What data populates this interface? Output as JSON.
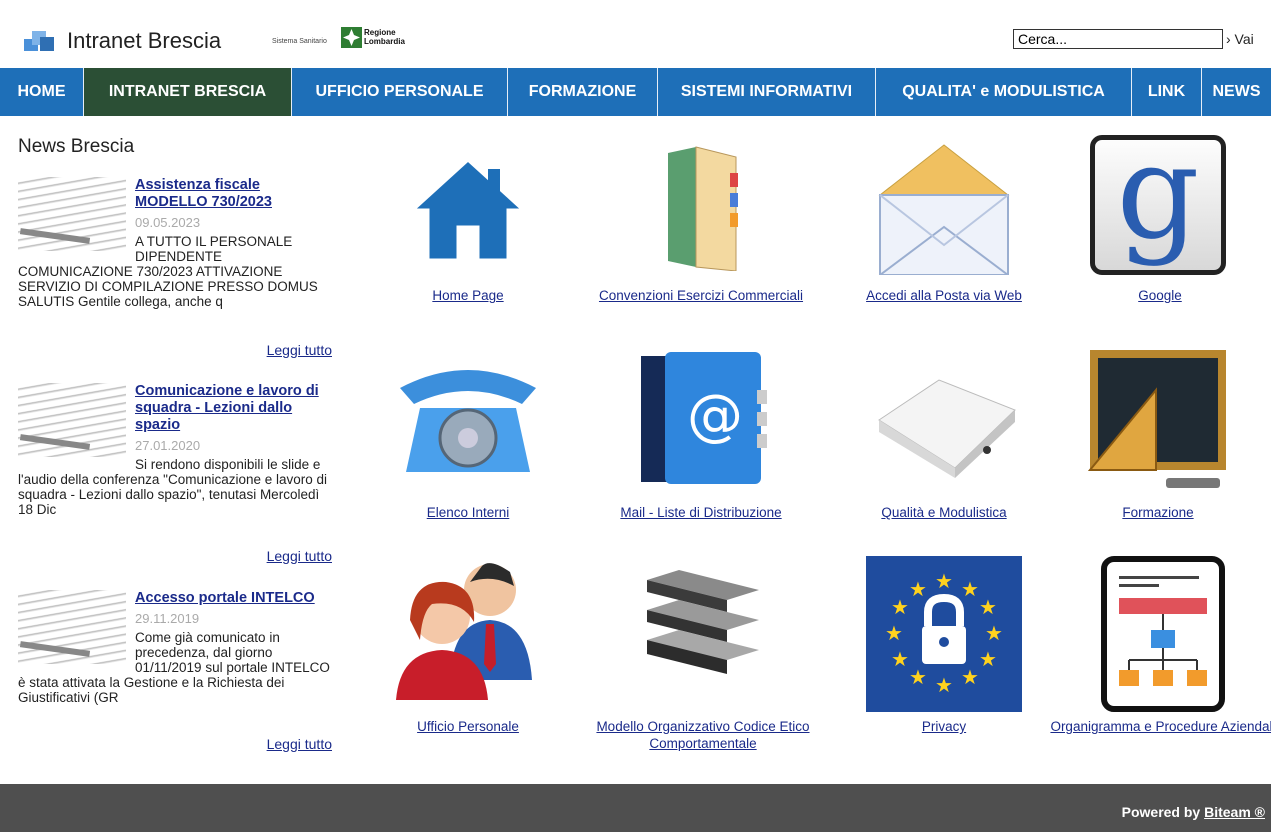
{
  "header": {
    "site_title": "Intranet Brescia",
    "sistema_sanitario": "Sistema Sanitario",
    "regione_line1": "Regione",
    "regione_line2": "Lombardia",
    "search_value": "Cerca...",
    "search_button": "› Vai"
  },
  "nav": {
    "items": [
      {
        "label": "HOME"
      },
      {
        "label": "INTRANET BRESCIA"
      },
      {
        "label": "UFFICIO PERSONALE"
      },
      {
        "label": "FORMAZIONE"
      },
      {
        "label": "SISTEMI INFORMATIVI"
      },
      {
        "label": "QUALITA' e MODULISTICA"
      },
      {
        "label": "LINK"
      },
      {
        "label": "NEWS"
      }
    ]
  },
  "news": {
    "title": "News Brescia",
    "items": [
      {
        "title": "Assistenza fiscale MODELLO 730/2023",
        "date": "09.05.2023",
        "body": "A TUTTO IL PERSONALE DIPENDENTE COMUNICAZIONE 730/2023 ATTIVAZIONE SERVIZIO DI COMPILAZIONE PRESSO DOMUS SALUTIS Gentile collega, anche q",
        "more": "Leggi tutto"
      },
      {
        "title": "Comunicazione e lavoro di squadra - Lezioni dallo spazio",
        "date": "27.01.2020",
        "body": "Si rendono disponibili le slide e l'audio della conferenza \"Comunicazione e lavoro di squadra - Lezioni dallo spazio\", tenutasi Mercoledì 18 Dic",
        "more": "Leggi tutto"
      },
      {
        "title": "Accesso portale INTELCO",
        "date": "29.11.2019",
        "body": "Come già comunicato in precedenza, dal giorno 01/11/2019 sul portale INTELCO è stata attivata la Gestione e la Richiesta dei Giustificativi (GR",
        "more": "Leggi tutto"
      }
    ]
  },
  "tiles": [
    {
      "label": "Home Page",
      "icon": "house-icon"
    },
    {
      "label": "Convenzioni Esercizi Commerciali",
      "icon": "folder-icon"
    },
    {
      "label": "Accedi alla Posta via Web",
      "icon": "envelope-icon"
    },
    {
      "label": "Google",
      "icon": "google-icon"
    },
    {
      "label": "Elenco Interni",
      "icon": "telephone-icon"
    },
    {
      "label": "Mail - Liste di Distribuzione",
      "icon": "address-book-icon"
    },
    {
      "label": "Qualità e Modulistica",
      "icon": "binder-icon"
    },
    {
      "label": "Formazione",
      "icon": "blackboard-icon"
    },
    {
      "label": "Ufficio Personale",
      "icon": "people-icon"
    },
    {
      "label": "Modello Organizzativo Codice Etico Comportamentale",
      "icon": "books-icon"
    },
    {
      "label": "Privacy",
      "icon": "eu-lock-icon"
    },
    {
      "label": "Organigramma e Procedure Aziendali",
      "icon": "org-chart-icon"
    }
  ],
  "google_letter": "g",
  "footer": {
    "powered_by": "Powered by",
    "brand": "Biteam ®"
  },
  "colors": {
    "nav_blue": "#1e6fb8",
    "nav_active": "#2b4f35",
    "footer_gray": "#4f4f4f",
    "link": "#1a2a8a"
  }
}
